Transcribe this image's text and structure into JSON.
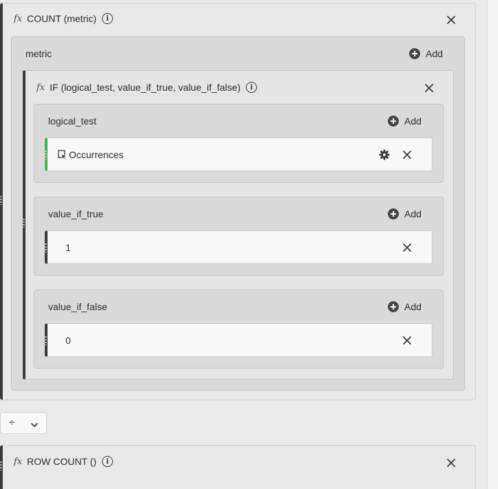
{
  "count_function": {
    "title": "COUNT (metric)",
    "slot": {
      "label": "metric",
      "add_label": "Add"
    }
  },
  "if_function": {
    "title": "IF (logical_test, value_if_true, value_if_false)",
    "slots": [
      {
        "label": "logical_test",
        "add_label": "Add",
        "item": {
          "type": "metric",
          "value": "Occurrences",
          "icon": "metric-cursor-icon"
        }
      },
      {
        "label": "value_if_true",
        "add_label": "Add",
        "item": {
          "type": "static-number",
          "value": "1"
        }
      },
      {
        "label": "value_if_false",
        "add_label": "Add",
        "item": {
          "type": "static-number",
          "value": "0"
        }
      }
    ]
  },
  "operator": {
    "symbol": "÷",
    "icon": "chevron-down-icon"
  },
  "row_count_function": {
    "title": "ROW COUNT ()"
  },
  "colors": {
    "accent_green": "#3eb655",
    "dark_rail": "#3a3a3a",
    "icon_dark": "#464646"
  },
  "icons": [
    "fx-icon",
    "info-icon",
    "plus-circle-icon",
    "close-icon",
    "gear-icon",
    "drag-handle-icon",
    "chevron-down-icon"
  ]
}
